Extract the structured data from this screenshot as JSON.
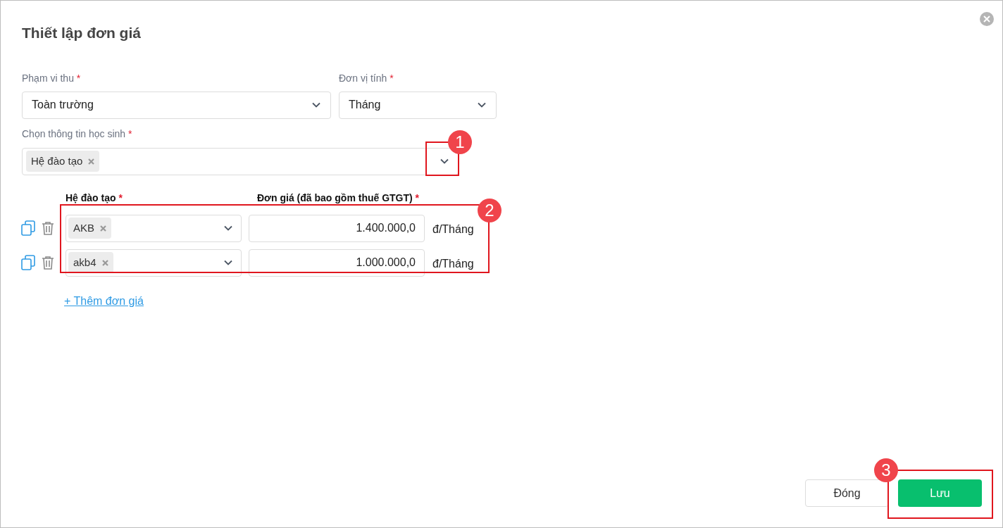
{
  "dialog": {
    "title": "Thiết lập đơn giá"
  },
  "fields": [
    {
      "label": "Phạm vi thu",
      "required_mark": "*",
      "value": "Toàn trường"
    },
    {
      "label": "Đơn vị tính",
      "required_mark": "*",
      "value": "Tháng"
    }
  ],
  "student_info": {
    "label": "Chọn thông tin học sinh",
    "required_mark": "*",
    "tags": [
      "Hệ đào tạo"
    ]
  },
  "price_table": {
    "columns": [
      {
        "label": "Hệ đào tạo",
        "required_mark": "*"
      },
      {
        "label": "Đơn giá (đã bao gồm thuế GTGT)",
        "required_mark": "*"
      }
    ],
    "rows": [
      {
        "tags": [
          "AKB"
        ],
        "price": "1.400.000,0",
        "unit": "đ/Tháng"
      },
      {
        "tags": [
          "akb4"
        ],
        "price": "1.000.000,0",
        "unit": "đ/Tháng"
      }
    ],
    "add_link": "+ Thêm đơn giá"
  },
  "buttons": [
    {
      "label": "Đóng",
      "kind": "secondary"
    },
    {
      "label": "Lưu",
      "kind": "primary"
    }
  ],
  "annotations": [
    {
      "number": "1"
    },
    {
      "number": "2"
    },
    {
      "number": "3"
    }
  ]
}
